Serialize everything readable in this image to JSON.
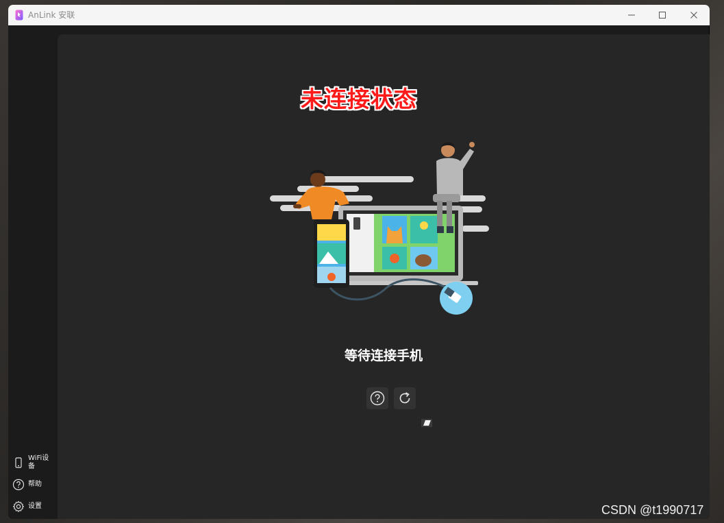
{
  "window": {
    "title": "AnLink 安联",
    "minimize_icon": "minimize-icon",
    "maximize_icon": "maximize-icon",
    "close_icon": "close-icon"
  },
  "sidebar": {
    "items": [
      {
        "label": "WiFi设备",
        "icon": "phone-icon"
      },
      {
        "label": "帮助",
        "icon": "help-circle-icon"
      },
      {
        "label": "设置",
        "icon": "gear-icon"
      }
    ]
  },
  "main": {
    "status_title": "未连接状态",
    "waiting_text": "等待连接手机",
    "actions": [
      {
        "icon": "help-circle-icon"
      },
      {
        "icon": "refresh-icon"
      }
    ]
  },
  "watermark": "CSDN @t1990717",
  "colors": {
    "title_red": "#ff1a1a",
    "main_bg": "#262626",
    "sidebar_bg": "#1b1b1b",
    "titlebar_bg": "#f5f5f5"
  }
}
